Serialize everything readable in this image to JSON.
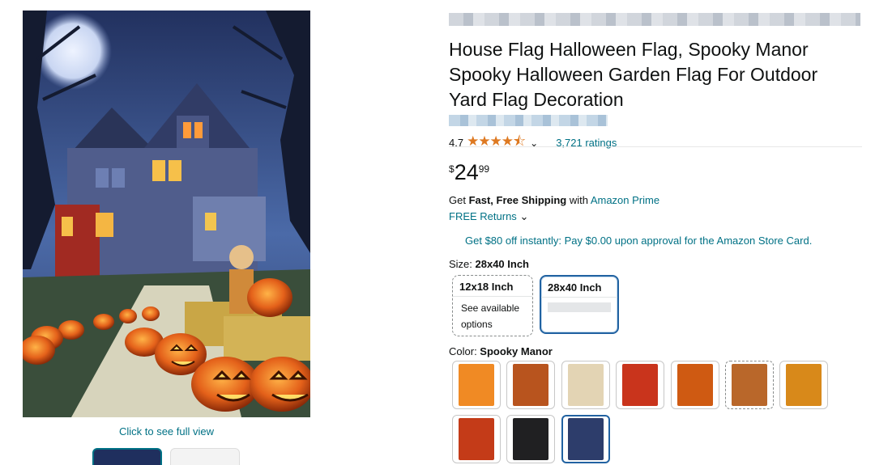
{
  "product": {
    "title": "House Flag Halloween Flag, Spooky Manor Spooky Halloween Garden Flag For Outdoor Yard Flag Decoration",
    "rating": "4.7",
    "stars": "★★★★⯪",
    "ratings_count": "3,721 ratings",
    "price": {
      "symbol": "$",
      "whole": "24",
      "fraction": "99"
    }
  },
  "gallery": {
    "full_view_link": "Click to see full view"
  },
  "shipping": {
    "prefix": "Get ",
    "bold": "Fast, Free Shipping",
    "middle": " with ",
    "prime_link": "Amazon Prime",
    "returns": "FREE Returns",
    "card_offer": "Get $80 off instantly: Pay $0.00 upon approval for the Amazon Store Card."
  },
  "size": {
    "label": "Size: ",
    "selected": "28x40 Inch",
    "options": [
      {
        "name": "12x18 Inch",
        "sub": "See available options"
      },
      {
        "name": "28x40 Inch",
        "sub": ""
      }
    ]
  },
  "color": {
    "label": "Color: ",
    "selected": "Spooky Manor",
    "swatch_colors": [
      "#f08a24",
      "#b8541e",
      "#e3d4b4",
      "#c9341c",
      "#cf5a12",
      "#b9672a",
      "#d8891a",
      "#c43b18",
      "#202022",
      "#2d3d6b"
    ]
  },
  "icons": {
    "chevron": "⌄"
  }
}
